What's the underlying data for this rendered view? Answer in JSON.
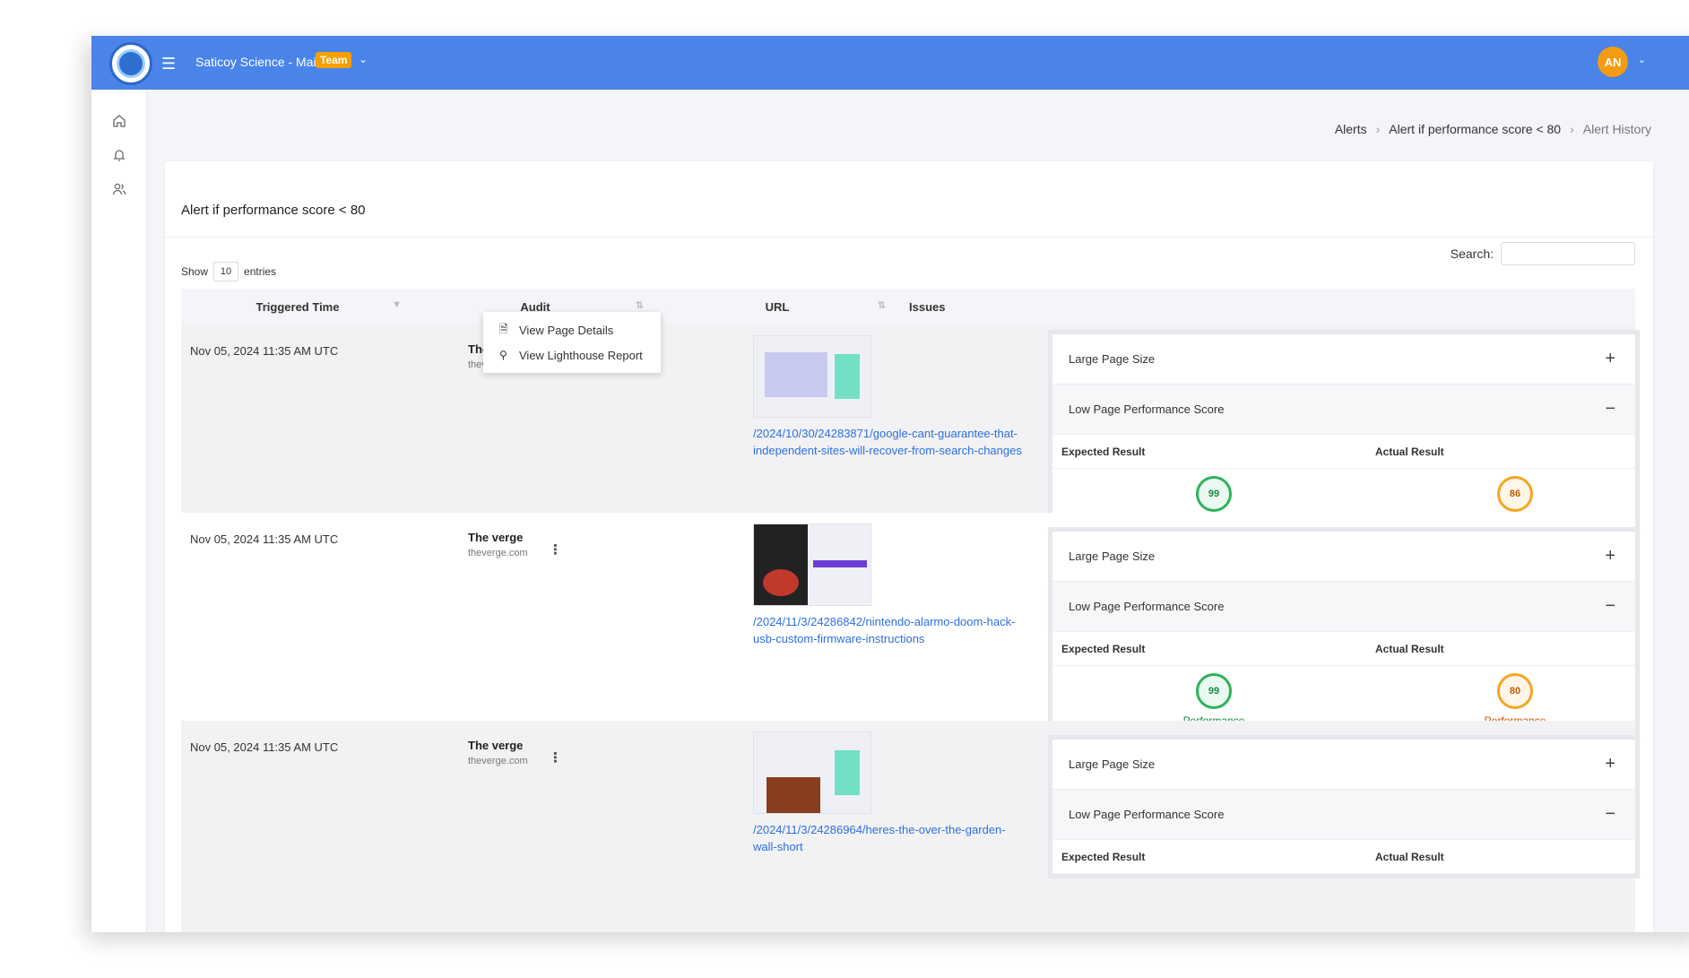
{
  "header": {
    "team_name": "Saticoy Science - Main",
    "team_badge": "Team",
    "avatar_initials": "AN"
  },
  "sidebar": {
    "items": [
      {
        "icon": "home-icon"
      },
      {
        "icon": "bell-icon"
      },
      {
        "icon": "users-icon"
      }
    ]
  },
  "breadcrumb": {
    "items": [
      "Alerts",
      "Alert if performance score < 80",
      "Alert History"
    ]
  },
  "card": {
    "title": "Alert if performance score < 80",
    "show_label": "Show",
    "entries_value": "10",
    "entries_label": "entries",
    "search_label": "Search:"
  },
  "table": {
    "headers": [
      "Triggered Time",
      "Audit",
      "URL",
      "Issues"
    ]
  },
  "context_menu": {
    "items": [
      "View Page Details",
      "View Lighthouse Report"
    ]
  },
  "issue_labels": {
    "large_page_size": "Large Page Size",
    "low_perf_score": "Low Page Performance Score",
    "expected": "Expected Result",
    "actual": "Actual Result",
    "metric": "Performance"
  },
  "rows": [
    {
      "time": "Nov 05, 2024 11:35 AM UTC",
      "audit_name": "The verge",
      "audit_domain": "theverge.com",
      "url": "/2024/10/30/24283871/google-cant-guarantee-that-independent-sites-will-recover-from-search-changes",
      "expected_score": "99",
      "actual_score": "86"
    },
    {
      "time": "Nov 05, 2024 11:35 AM UTC",
      "audit_name": "The verge",
      "audit_domain": "theverge.com",
      "url": "/2024/11/3/24286842/nintendo-alarmo-doom-hack-usb-custom-firmware-instructions",
      "expected_score": "99",
      "actual_score": "80"
    },
    {
      "time": "Nov 05, 2024 11:35 AM UTC",
      "audit_name": "The verge",
      "audit_domain": "theverge.com",
      "url": "/2024/11/3/24286964/heres-the-over-the-garden-wall-short",
      "expected_score": "",
      "actual_score": ""
    }
  ]
}
